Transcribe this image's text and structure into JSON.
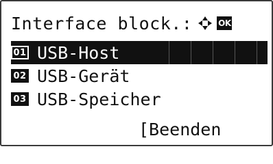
{
  "header": {
    "title": "Interface block.:",
    "nav_icon": "four-way-arrow-icon",
    "ok_label": "OK"
  },
  "menu": {
    "items": [
      {
        "number": "01",
        "label": "USB-Host",
        "selected": true
      },
      {
        "number": "02",
        "label": "USB-Gerät",
        "selected": false
      },
      {
        "number": "03",
        "label": "USB-Speicher",
        "selected": false
      }
    ]
  },
  "footer": {
    "exit_label": "[Beenden"
  },
  "colors": {
    "foreground": "#111111",
    "background": "#ffffff"
  }
}
